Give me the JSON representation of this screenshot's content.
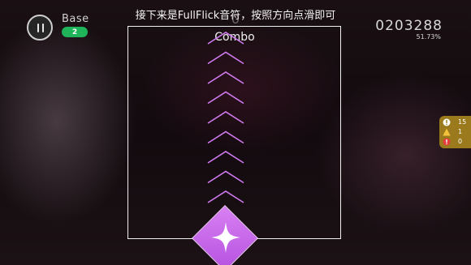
{
  "hud": {
    "difficulty": "Base",
    "level": "2",
    "instruction": "接下来是FullFlick音符，按照方向点滑即可",
    "score": "0203288",
    "accuracy": "51.73%",
    "combo_label": "Combo",
    "combo_count": "0"
  },
  "judge_counts": [
    {
      "icon": "white-exclamation-icon",
      "value": "15"
    },
    {
      "icon": "yellow-triangle-icon",
      "value": "1"
    },
    {
      "icon": "red-exclamation-icon",
      "value": "0"
    }
  ],
  "note": {
    "type": "flick",
    "direction": "up",
    "arrow_icon": "chevron-up-icon",
    "arrow_count": 9,
    "note_icon": "sparkle-star-icon"
  },
  "colors": {
    "note_purple": "#c865ea",
    "arrow_purple": "#d07af0",
    "badge_green": "#1fb35a",
    "judge_panel": "#9a7a1c"
  }
}
